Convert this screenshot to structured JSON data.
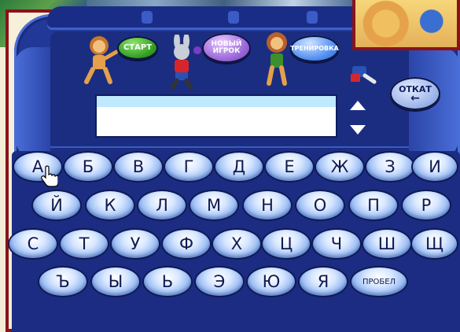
{
  "buttons": {
    "start": "СТАРТ",
    "new_player_line1": "НОВЫЙ",
    "new_player_line2": "ИГРОК",
    "training": "ТРЕНИРОВКА",
    "back": "ОТКАТ"
  },
  "display": {
    "text": ""
  },
  "keyboard": {
    "row1": [
      "А",
      "Б",
      "В",
      "Г",
      "Д",
      "Е",
      "Ж",
      "З",
      "И"
    ],
    "row2": [
      "Й",
      "К",
      "Л",
      "М",
      "Н",
      "О",
      "П",
      "Р"
    ],
    "row3": [
      "С",
      "Т",
      "У",
      "Ф",
      "Х",
      "Ц",
      "Ч",
      "Ш",
      "Щ"
    ],
    "row4": [
      "Ъ",
      "Ы",
      "Ь",
      "Э",
      "Ю",
      "Я"
    ],
    "space": "ПРОБЕЛ"
  },
  "icons": [
    "lion-icon",
    "rabbit-icon",
    "lion-icon",
    "character-icon",
    "up-arrow-icon",
    "down-arrow-icon",
    "back-arrow-icon",
    "hand-cursor-icon"
  ]
}
